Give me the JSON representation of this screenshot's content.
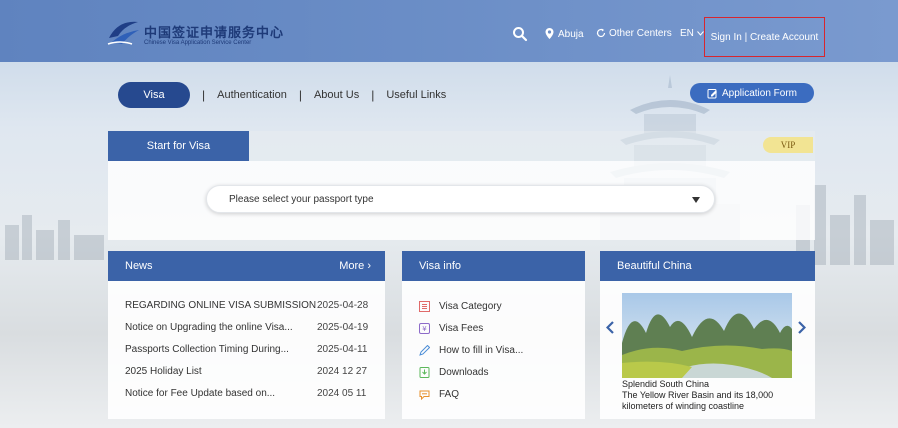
{
  "header": {
    "logo_cn": "中国签证申请服务中心",
    "logo_en": "Chinese Visa Application Service Center",
    "location": "Abuja",
    "other_centers": "Other Centers",
    "language": "EN",
    "sign_in": "Sign In | Create Account"
  },
  "nav": {
    "tabs": [
      {
        "label": "Visa"
      },
      {
        "label": "Authentication"
      },
      {
        "label": "About Us"
      },
      {
        "label": "Useful Links"
      }
    ],
    "application_form": "Application Form"
  },
  "visa_panel": {
    "tab_label": "Start for Visa",
    "vip": "VIP",
    "passport_placeholder": "Please select your passport type"
  },
  "news": {
    "title": "News",
    "more": "More",
    "items": [
      {
        "title": "REGARDING ONLINE VISA SUBMISSION",
        "date": "2025-04-28"
      },
      {
        "title": "Notice on Upgrading the online Visa...",
        "date": "2025-04-19"
      },
      {
        "title": "Passports Collection Timing During...",
        "date": "2025-04-11"
      },
      {
        "title": "2025 Holiday List",
        "date": "2024 12 27"
      },
      {
        "title": "Notice for Fee Update based on...",
        "date": "2024 05 11"
      }
    ]
  },
  "visa_info": {
    "title": "Visa info",
    "items": [
      {
        "label": "Visa Category",
        "icon": "category-icon"
      },
      {
        "label": "Visa Fees",
        "icon": "fees-icon"
      },
      {
        "label": "How to fill in Visa...",
        "icon": "pen-icon"
      },
      {
        "label": "Downloads",
        "icon": "download-icon"
      },
      {
        "label": "FAQ",
        "icon": "faq-icon"
      }
    ]
  },
  "beautiful_china": {
    "title": "Beautiful China",
    "caption_title": "Splendid South China",
    "caption_text": "The Yellow River Basin and its 18,000 kilometers of winding coastline"
  },
  "colors": {
    "header_bg": "#6a8dc6",
    "primary": "#26498f",
    "panel_head": "#3b63a8",
    "highlight_border": "#d7262e",
    "vip": "#f2e493"
  }
}
